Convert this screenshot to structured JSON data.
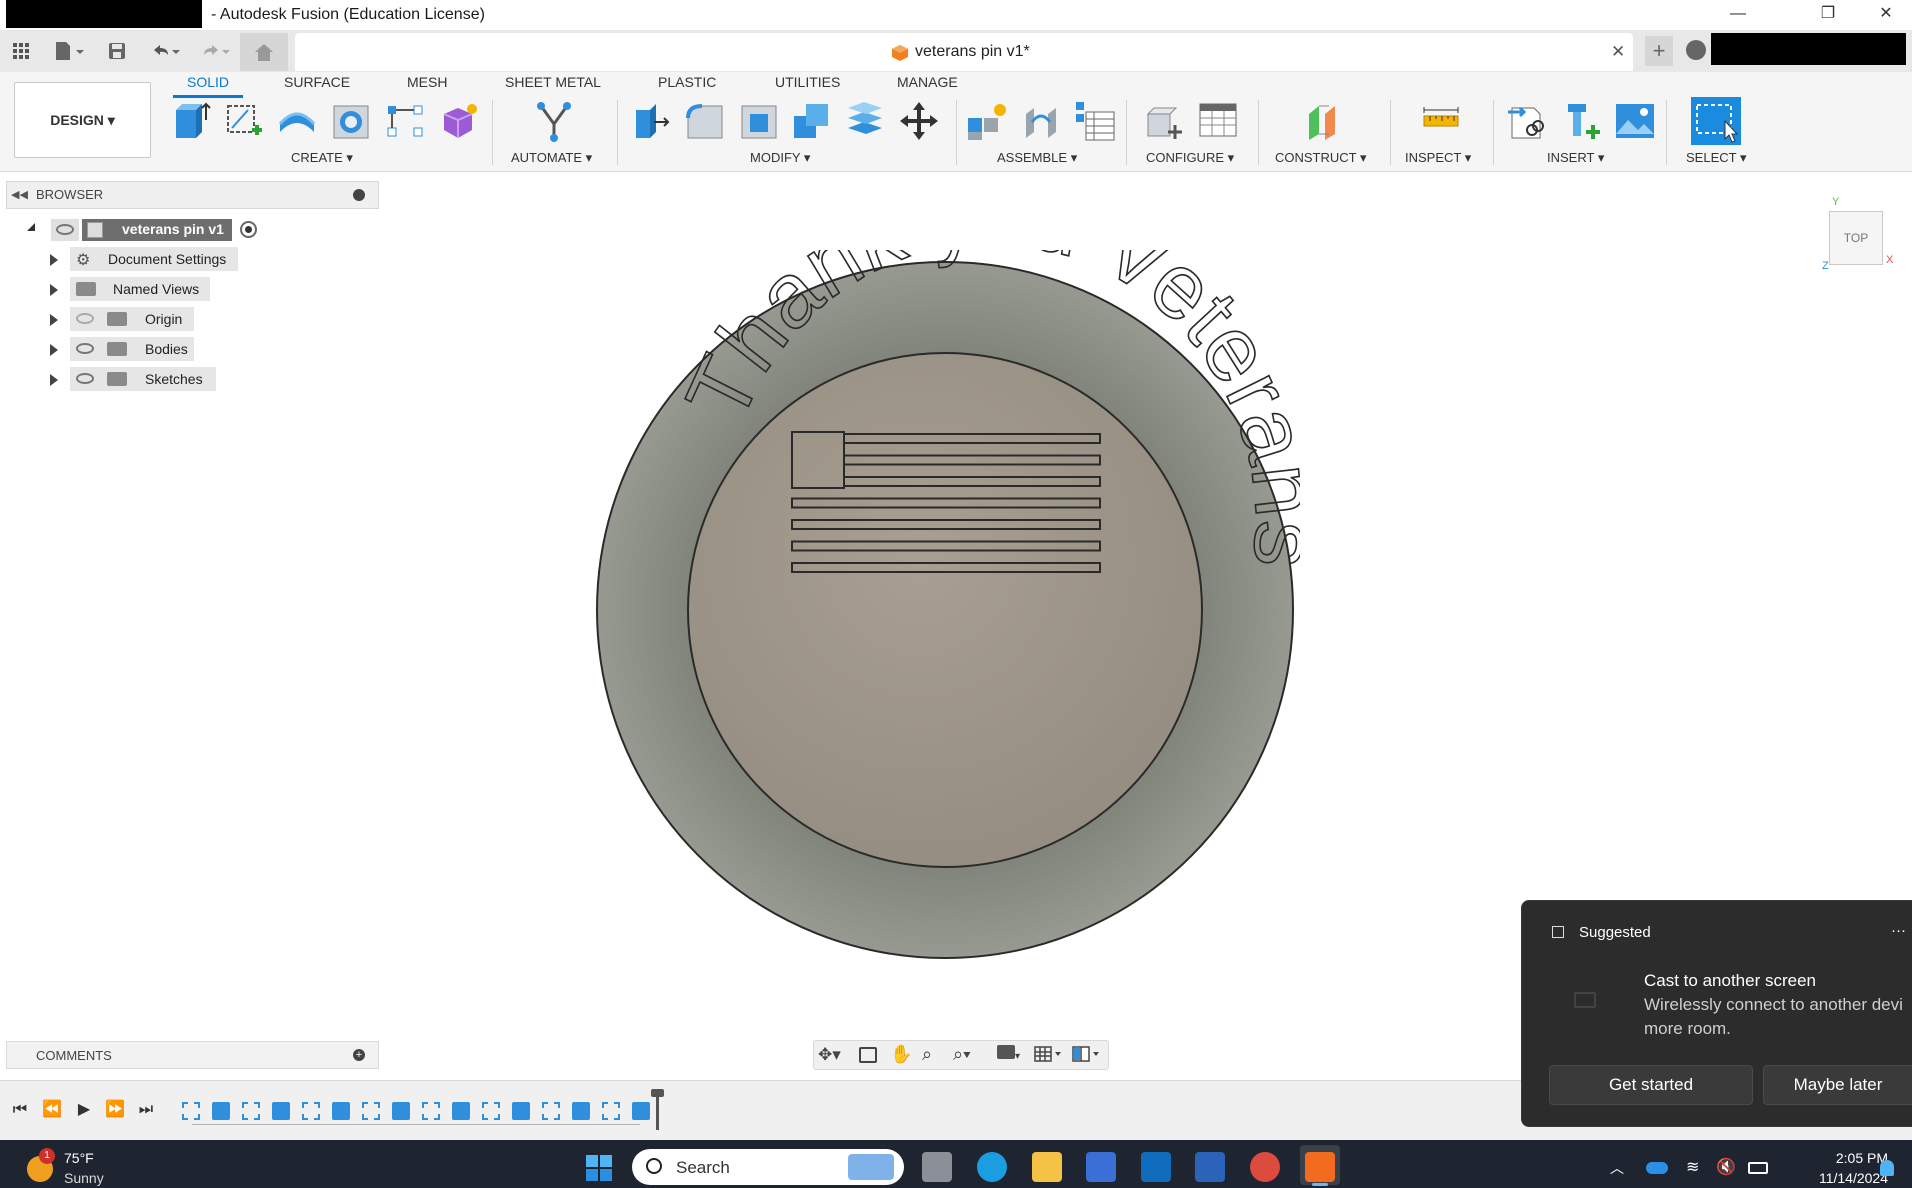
{
  "window": {
    "title": "- Autodesk Fusion (Education License)",
    "minimize": "—",
    "restore": "❐",
    "close": "✕"
  },
  "document": {
    "tab_title": "veterans pin v1*",
    "close": "✕",
    "new_tab": "+"
  },
  "ribbon": {
    "workspace": "DESIGN ▾",
    "tabs": [
      "SOLID",
      "SURFACE",
      "MESH",
      "SHEET METAL",
      "PLASTIC",
      "UTILITIES",
      "MANAGE"
    ],
    "active_tab": "SOLID",
    "groups": [
      "CREATE ▾",
      "AUTOMATE ▾",
      "MODIFY ▾",
      "ASSEMBLE ▾",
      "CONFIGURE ▾",
      "CONSTRUCT ▾",
      "INSPECT ▾",
      "INSERT ▾",
      "SELECT ▾"
    ]
  },
  "browser": {
    "title": "BROWSER",
    "root": "veterans pin v1",
    "items": [
      "Document Settings",
      "Named Views",
      "Origin",
      "Bodies",
      "Sketches"
    ]
  },
  "model": {
    "engraved_text": "Thank you Veterans",
    "stripe_count": 7,
    "outer_color": "#8c8f87",
    "inner_color": "#9e978b"
  },
  "viewcube": {
    "face": "TOP",
    "axis_y": "Y",
    "axis_x": "X",
    "axis_z": "Z"
  },
  "comments": {
    "title": "COMMENTS"
  },
  "toast": {
    "header": "Suggested",
    "more": "···",
    "title": "Cast to another screen",
    "body_line1": "Wirelessly connect to another devi",
    "body_line2": "more room.",
    "primary_button": "Get started",
    "secondary_button": "Maybe later"
  },
  "taskbar": {
    "weather_temp": "75°F",
    "weather_desc": "Sunny",
    "weather_badge": "1",
    "search_placeholder": "Search",
    "time": "2:05 PM",
    "date": "11/14/2024"
  },
  "colors": {
    "accent": "#0a7bd0",
    "taskbar": "#1f2530",
    "toast": "#2c2c2c"
  }
}
